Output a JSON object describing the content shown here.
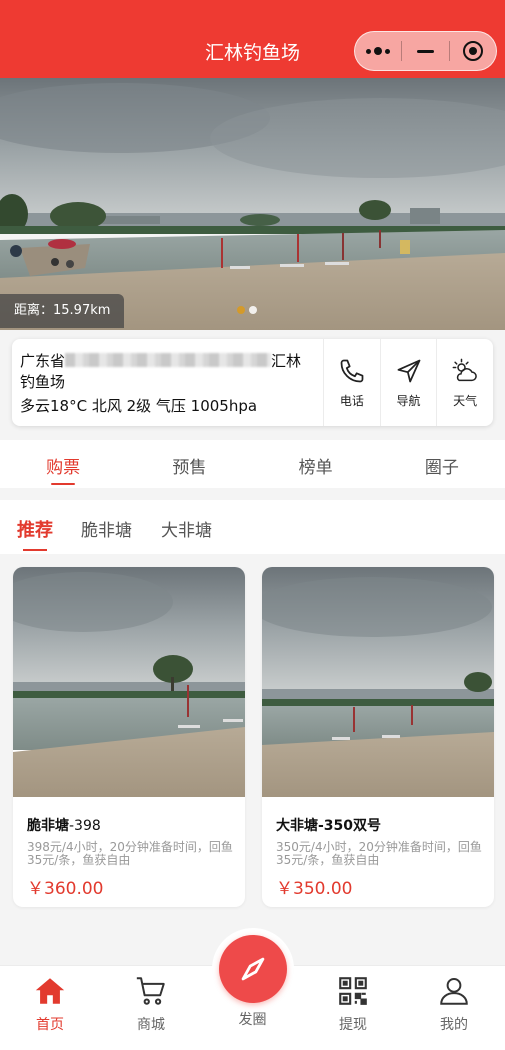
{
  "header": {
    "title": "汇林钓鱼场",
    "menu_icon": "more-dots-icon",
    "minimize_icon": "minimize-icon",
    "close_icon": "target-close-icon",
    "bg_color": "#ee3a32"
  },
  "banner": {
    "distance_label": "距离：15.97km",
    "slide_count": 2,
    "active_slide": 1
  },
  "info": {
    "address_prefix": "广东省",
    "address_suffix": "汇林",
    "address_line2": "钓鱼场",
    "weather": "多云18°C  北风 2级 气压 1005hpa",
    "actions": [
      {
        "label": "电话",
        "icon": "phone-icon"
      },
      {
        "label": "导航",
        "icon": "navigation-icon"
      },
      {
        "label": "天气",
        "icon": "weather-icon"
      }
    ]
  },
  "main_tabs": [
    {
      "label": "购票",
      "active": true
    },
    {
      "label": "预售",
      "active": false
    },
    {
      "label": "榜单",
      "active": false
    },
    {
      "label": "圈子",
      "active": false
    }
  ],
  "sub_tabs": [
    {
      "label": "推荐",
      "active": true
    },
    {
      "label": "脆非塘",
      "active": false
    },
    {
      "label": "大非塘",
      "active": false
    }
  ],
  "cards": [
    {
      "title_main": "脆非塘",
      "title_suffix": "-398",
      "desc": "398元/4小时，20分钟准备时间，回鱼35元/条，鱼获自由",
      "price": "￥360.00"
    },
    {
      "title_main": "大非塘",
      "title_suffix": "-350双号",
      "desc": "350元/4小时，20分钟准备时间，回鱼35元/条，鱼获自由",
      "price": "￥350.00"
    }
  ],
  "bottom_nav": {
    "items": [
      {
        "label": "首页",
        "icon": "home-icon",
        "active": true
      },
      {
        "label": "商城",
        "icon": "cart-icon",
        "active": false
      },
      {
        "label": "发圈",
        "icon": "compass-icon",
        "active": false
      },
      {
        "label": "提现",
        "icon": "qrcode-icon",
        "active": false
      },
      {
        "label": "我的",
        "icon": "user-icon",
        "active": false
      }
    ]
  },
  "colors": {
    "accent": "#e23a2e",
    "fab": "#ee4a4a",
    "banner_dot_active": "#d49a2a"
  }
}
